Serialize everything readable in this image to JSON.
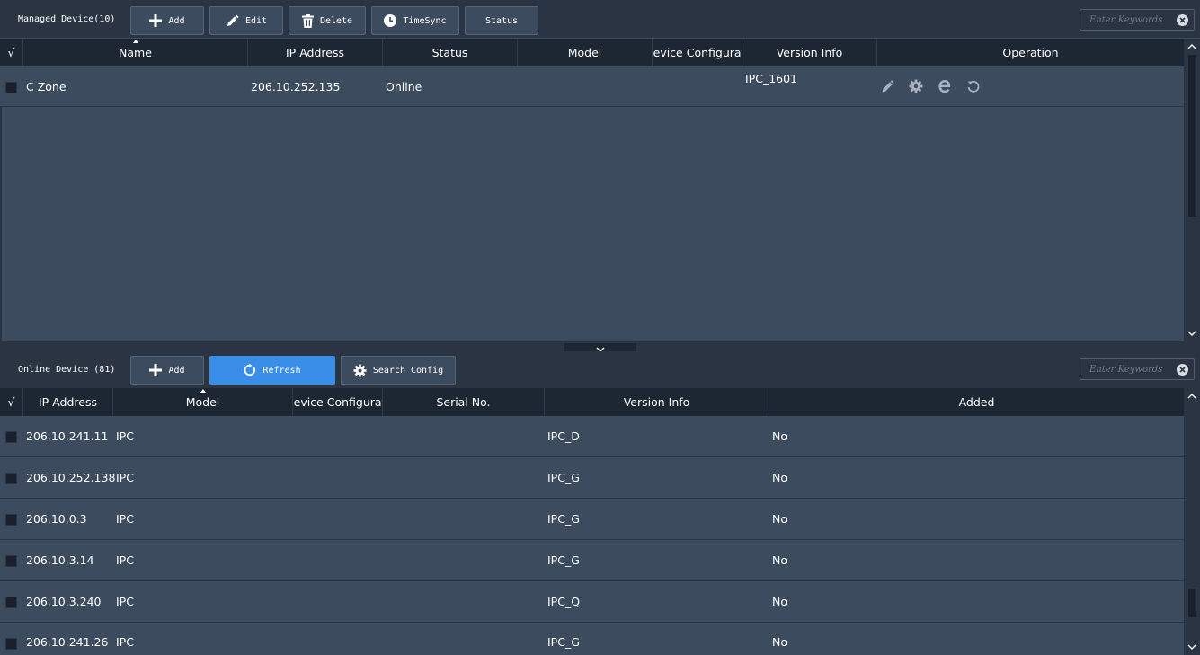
{
  "managed": {
    "title": "Managed Device(10)",
    "buttons": {
      "add": "Add",
      "edit": "Edit",
      "delete": "Delete",
      "timesync": "TimeSync",
      "status": "Status"
    },
    "search_placeholder": "Enter Keywords",
    "columns": {
      "check": "√",
      "name": "Name",
      "ip": "IP Address",
      "status": "Status",
      "model": "Model",
      "device_config": "Device Configuration",
      "version": "Version Info",
      "operation": "Operation"
    },
    "rows": [
      {
        "name": "C Zone",
        "ip": "206.10.252.135",
        "status": "Online",
        "model": "",
        "device_config": "",
        "version": "IPC_1601"
      }
    ],
    "operation_icons": [
      "edit-icon",
      "gear-icon",
      "browser-e-icon",
      "restart-icon"
    ]
  },
  "online": {
    "title": "Online Device (81)",
    "buttons": {
      "add": "Add",
      "refresh": "Refresh",
      "search_config": "Search Config"
    },
    "search_placeholder": "Enter Keywords",
    "columns": {
      "check": "√",
      "ip": "IP Address",
      "model": "Model",
      "device_config": "Device Configuration",
      "serial": "Serial No.",
      "version": "Version Info",
      "added": "Added"
    },
    "rows": [
      {
        "ip": "206.10.241.11",
        "model": "IPC",
        "version": "IPC_D",
        "added": "No"
      },
      {
        "ip": "206.10.252.138",
        "model": "IPC",
        "version": "IPC_G",
        "added": "No"
      },
      {
        "ip": "206.10.0.3",
        "model": "IPC",
        "version": "IPC_G",
        "added": "No"
      },
      {
        "ip": "206.10.3.14",
        "model": "IPC",
        "version": "IPC_G",
        "added": "No"
      },
      {
        "ip": "206.10.3.240",
        "model": "IPC",
        "version": "IPC_Q",
        "added": "No"
      },
      {
        "ip": "206.10.241.26",
        "model": "IPC",
        "version": "IPC_G",
        "added": "No"
      }
    ]
  },
  "colors": {
    "background": "#3d4b5e",
    "toolbar": "#2a3443",
    "header": "#1d2633",
    "accent": "#3b8ee8"
  }
}
